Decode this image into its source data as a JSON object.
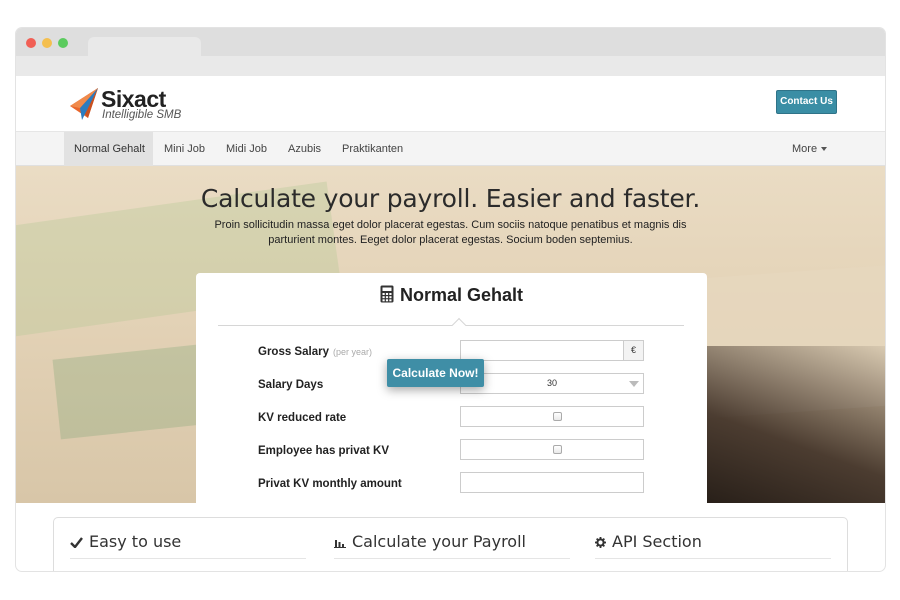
{
  "brand": {
    "name": "Sixact",
    "tagline": "Intelligible SMB"
  },
  "header": {
    "contact_label": "Contact Us"
  },
  "nav": {
    "items": [
      {
        "label": "Normal Gehalt",
        "active": true
      },
      {
        "label": "Mini Job"
      },
      {
        "label": "Midi Job"
      },
      {
        "label": "Azubis"
      },
      {
        "label": "Praktikanten"
      }
    ],
    "more_label": "More"
  },
  "hero": {
    "title": "Calculate your payroll. Easier and faster.",
    "subtitle": "Proin sollicitudin massa eget dolor placerat egestas. Cum sociis natoque penatibus et magnis dis parturient montes. Eeget dolor placerat egestas. Socium boden septemius."
  },
  "calculator": {
    "title": "Normal Gehalt",
    "icon": "calculator-icon",
    "rows": {
      "gross_salary": {
        "label": "Gross Salary",
        "hint": "(per year)",
        "value": "",
        "currency": "€"
      },
      "salary_days": {
        "label": "Salary Days",
        "value": "30"
      },
      "kv_reduced_rate": {
        "label": "KV reduced rate",
        "checked": false
      },
      "employee_privat_kv": {
        "label": "Employee has privat KV",
        "checked": false
      },
      "privat_kv_monthly": {
        "label": "Privat KV monthly amount",
        "value": ""
      }
    },
    "calculate_label": "Calculate Now!"
  },
  "features": [
    {
      "icon": "checkmark-icon",
      "label": "Easy to use"
    },
    {
      "icon": "bar-chart-icon",
      "label": "Calculate your Payroll"
    },
    {
      "icon": "gear-icon",
      "label": "API Section"
    }
  ],
  "colors": {
    "accent": "#3f8ea6",
    "logo_orange": "#e8662c",
    "logo_blue": "#2b7cc0"
  }
}
